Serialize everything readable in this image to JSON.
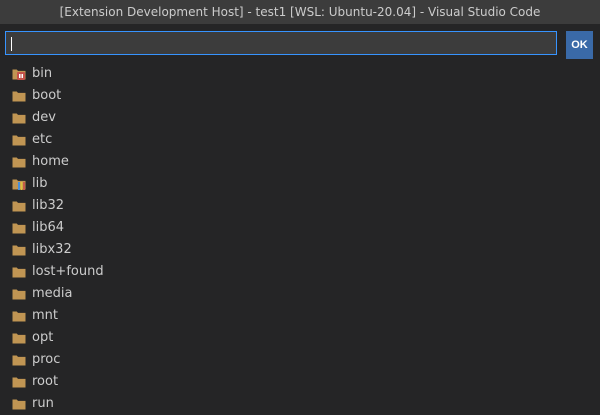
{
  "window": {
    "title": "[Extension Development Host] - test1 [WSL: Ubuntu-20.04] - Visual Studio Code"
  },
  "quick_input": {
    "value": "",
    "placeholder": "",
    "ok_label": "OK"
  },
  "colors": {
    "folder": "#c09553",
    "accent": "#3794ff",
    "ok_button": "#3a6aa8"
  },
  "items": [
    {
      "label": "bin",
      "icon": "bin-folder-icon"
    },
    {
      "label": "boot",
      "icon": "folder-icon"
    },
    {
      "label": "dev",
      "icon": "folder-icon"
    },
    {
      "label": "etc",
      "icon": "folder-icon"
    },
    {
      "label": "home",
      "icon": "folder-icon"
    },
    {
      "label": "lib",
      "icon": "lib-folder-icon"
    },
    {
      "label": "lib32",
      "icon": "folder-icon"
    },
    {
      "label": "lib64",
      "icon": "folder-icon"
    },
    {
      "label": "libx32",
      "icon": "folder-icon"
    },
    {
      "label": "lost+found",
      "icon": "folder-icon"
    },
    {
      "label": "media",
      "icon": "folder-icon"
    },
    {
      "label": "mnt",
      "icon": "folder-icon"
    },
    {
      "label": "opt",
      "icon": "folder-icon"
    },
    {
      "label": "proc",
      "icon": "folder-icon"
    },
    {
      "label": "root",
      "icon": "folder-icon"
    },
    {
      "label": "run",
      "icon": "folder-icon"
    }
  ]
}
